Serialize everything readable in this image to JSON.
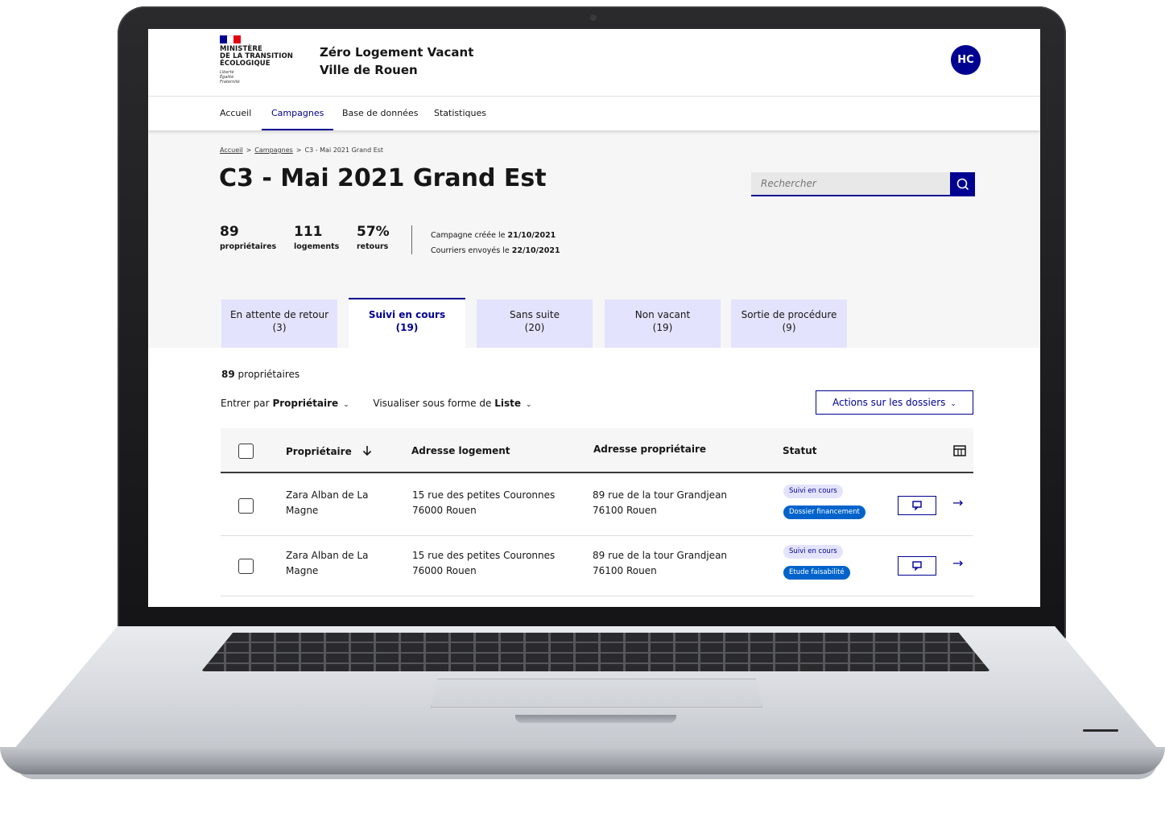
{
  "header": {
    "ministry_name": "MINISTÈRE\nDE LA TRANSITION\nÉCOLOGIQUE",
    "motto": "Liberté\nÉgalité\nFraternité",
    "service_title": "Zéro Logement Vacant",
    "service_subtitle": "Ville de Rouen",
    "avatar_initials": "HC"
  },
  "nav": {
    "items": [
      "Accueil",
      "Campagnes",
      "Base de données",
      "Statistiques"
    ],
    "active": "Campagnes"
  },
  "breadcrumb": {
    "items": [
      "Accueil",
      "Campagnes",
      "C3 - Mai 2021 Grand Est"
    ],
    "separator": ">"
  },
  "page": {
    "title": "C3 - Mai 2021 Grand Est",
    "search_placeholder": "Rechercher"
  },
  "stats": [
    {
      "value": "89",
      "label": "propriétaires"
    },
    {
      "value": "111",
      "label": "logements"
    },
    {
      "value": "57%",
      "label": "retours"
    }
  ],
  "campaign_dates": {
    "created_prefix": "Campagne créée le",
    "created_date": "21/10/2021",
    "sent_prefix": "Courriers envoyés le",
    "sent_date": "22/10/2021"
  },
  "tabs": [
    {
      "label": "En attente de retour",
      "count": "(3)"
    },
    {
      "label": "Suivi en cours",
      "count": "(19)"
    },
    {
      "label": "Sans suite",
      "count": "(20)"
    },
    {
      "label": "Non vacant",
      "count": "(19)"
    },
    {
      "label": "Sortie de procédure",
      "count": "(9)"
    }
  ],
  "active_tab": "Suivi en cours",
  "list": {
    "count": "89",
    "count_label": "propriétaires",
    "filter1_label": "Entrer par",
    "filter1_value": "Propriétaire",
    "filter2_label": "Visualiser sous forme de",
    "filter2_value": "Liste",
    "actions_label": "Actions sur les dossiers"
  },
  "table": {
    "headers": [
      "Propriétaire",
      "Adresse logement",
      "Adresse propriétaire",
      "Statut"
    ],
    "rows": [
      {
        "owner_line1": "Zara Alban de La",
        "owner_line2": "Magne",
        "housing_line1": "15 rue des petites Couronnes",
        "housing_line2": "76000 Rouen",
        "owner_addr_line1": "89 rue de la tour Grandjean",
        "owner_addr_line2": "76100 Rouen",
        "status": "Suivi en cours",
        "substatus": "Dossier financement"
      },
      {
        "owner_line1": "Zara Alban de La",
        "owner_line2": "Magne",
        "housing_line1": "15 rue des petites Couronnes",
        "housing_line2": "76000 Rouen",
        "owner_addr_line1": "89 rue de la tour Grandjean",
        "owner_addr_line2": "76100 Rouen",
        "status": "Suivi en cours",
        "substatus": "Etude faisabilité"
      }
    ]
  },
  "colors": {
    "primary": "#000091",
    "badge_light_bg": "#e3e3fd",
    "badge_dark_bg": "#0063cb",
    "hero_bg": "#f6f6f6"
  },
  "icons": [
    "search-icon",
    "sort-down-arrow-icon",
    "column-settings-icon",
    "comment-icon",
    "arrow-right-icon",
    "chevron-down-icon"
  ]
}
